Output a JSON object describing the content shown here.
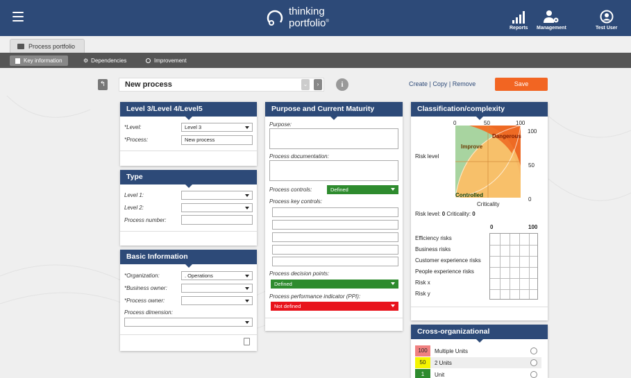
{
  "header": {
    "logo_line1": "thinking",
    "logo_line2": "portfolio",
    "nav": [
      {
        "label": "Reports",
        "icon": "bar-chart-icon"
      },
      {
        "label": "Management",
        "icon": "users-gear-icon"
      },
      {
        "label": "Test User",
        "icon": "user-icon"
      }
    ]
  },
  "tabs": {
    "portfolio": "Process portfolio"
  },
  "subtabs": [
    {
      "label": "Key information",
      "icon": "document-icon",
      "active": true
    },
    {
      "label": "Dependencies",
      "icon": "cogs-icon",
      "active": false
    },
    {
      "label": "Improvement",
      "icon": "circle-icon",
      "active": false
    }
  ],
  "toolbar": {
    "process_name": "New process",
    "links": "Create | Copy | Remove",
    "save": "Save"
  },
  "level_panel": {
    "title": "Level 3/Level 4/Level5",
    "level_label": "*Level:",
    "level_value": "Level 3",
    "process_label": "*Process:",
    "process_value": "New process"
  },
  "type_panel": {
    "title": "Type",
    "level1_label": "Level 1:",
    "level2_label": "Level 2:",
    "number_label": "Process number:"
  },
  "basic_panel": {
    "title": "Basic Information",
    "org_label": "*Organization:",
    "org_value": ". Operations",
    "business_owner_label": "*Business owner:",
    "process_owner_label": "*Process owner:",
    "dimension_label": "Process dimension:"
  },
  "purpose_panel": {
    "title": "Purpose and Current Maturity",
    "purpose_label": "Purpose:",
    "doc_label": "Process documentation:",
    "controls_label": "Process controls:",
    "controls_value": "Defined",
    "key_controls_label": "Process key controls:",
    "decision_label": "Process decision points:",
    "decision_value": "Defined",
    "ppi_label": "Process performance indicator (PPI):",
    "ppi_value": "Not defined"
  },
  "classification_panel": {
    "title": "Classification/complexity",
    "x_ticks": [
      "0",
      "50",
      "100"
    ],
    "y_ticks": [
      "100",
      "50",
      "0"
    ],
    "y_axis_label": "Risk level",
    "x_axis_label": "Criticality",
    "zones": {
      "dangerous": "Dangerous",
      "improve": "Improve",
      "controlled": "Controlled"
    },
    "risk_level_label": "Risk level:",
    "risk_level_value": "0",
    "criticality_label": "Criticality:",
    "criticality_value": "0",
    "scale_min": "0",
    "scale_max": "100",
    "risks": [
      "Efficiency risks",
      "Business risks",
      "Customer experience risks",
      "People experience risks",
      "Risk x",
      "Risk y"
    ]
  },
  "cross_panel": {
    "title": "Cross-organizational",
    "rows": [
      {
        "num": "100",
        "label": "Multiple Units",
        "color": "#f08080"
      },
      {
        "num": "50",
        "label": "2 Units",
        "color": "#f5f500"
      },
      {
        "num": "1",
        "label": "Unit",
        "color": "#2e8b2e"
      }
    ]
  },
  "colors": {
    "header": "#2d4a78",
    "save": "#f26522",
    "defined": "#2e8b2e",
    "not_defined": "#e8141c"
  }
}
